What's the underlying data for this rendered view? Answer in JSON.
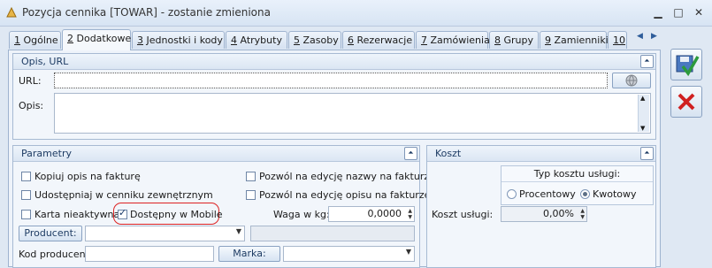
{
  "window": {
    "title": "Pozycja cennika [TOWAR] - zostanie zmieniona"
  },
  "tabs": [
    {
      "num": "1",
      "label": "Ogólne"
    },
    {
      "num": "2",
      "label": "Dodatkowe"
    },
    {
      "num": "3",
      "label": "Jednostki i kody"
    },
    {
      "num": "4",
      "label": "Atrybuty"
    },
    {
      "num": "5",
      "label": "Zasoby"
    },
    {
      "num": "6",
      "label": "Rezerwacje"
    },
    {
      "num": "7",
      "label": "Zamówienia"
    },
    {
      "num": "8",
      "label": "Grupy"
    },
    {
      "num": "9",
      "label": "Zamienniki"
    },
    {
      "num": "10",
      "label": ""
    }
  ],
  "opis_url": {
    "title": "Opis, URL",
    "url_label": "URL:",
    "url_value": "",
    "opis_label": "Opis:",
    "opis_value": ""
  },
  "parametry": {
    "title": "Parametry",
    "kopiuj": "Kopiuj opis na fakturę",
    "udostepniaj": "Udostępniaj w cenniku zewnętrznym",
    "karta": "Karta nieaktywna",
    "dostepny": "Dostępny w Mobile",
    "dostepny_checked": true,
    "pozwol_nazwy": "Pozwól na edycję nazwy na fakturze",
    "pozwol_opisu": "Pozwól na edycję opisu na fakturze",
    "waga_label": "Waga w kg:",
    "waga_value": "0,0000",
    "producent_btn": "Producent:",
    "producent_value": "",
    "kod_label": "Kod producenta",
    "kod_value": "",
    "marka_btn": "Marka:",
    "marka_value": ""
  },
  "koszt": {
    "title": "Koszt",
    "typ_label": "Typ kosztu usługi:",
    "procentowy": "Procentowy",
    "kwotowy": "Kwotowy",
    "selected": "Kwotowy",
    "koszt_label": "Koszt usługi:",
    "koszt_value": "0,00%"
  }
}
